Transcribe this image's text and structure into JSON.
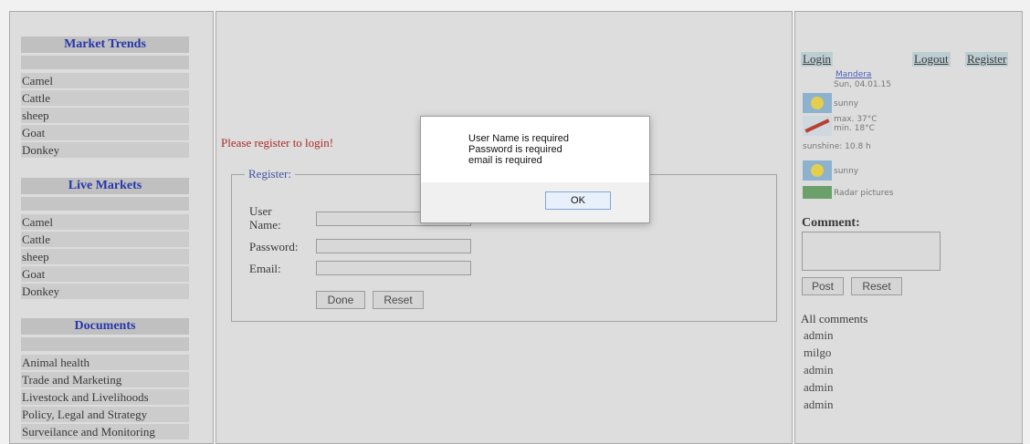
{
  "sidebar": {
    "sections": [
      {
        "title": "Market Trends",
        "items": [
          "Camel",
          "Cattle",
          "sheep",
          "Goat",
          "Donkey"
        ]
      },
      {
        "title": "Live Markets",
        "items": [
          "Camel",
          "Cattle",
          "sheep",
          "Goat",
          "Donkey"
        ]
      },
      {
        "title": "Documents",
        "items": [
          "Animal health",
          "Trade and Marketing",
          "Livestock and Livelihoods",
          "Policy, Legal and Strategy",
          "Surveilance and Monitoring"
        ]
      }
    ]
  },
  "main": {
    "message": "Please register to login!",
    "form": {
      "legend": "Register:",
      "user_label": "User Name:",
      "password_label": "Password:",
      "email_label": "Email:",
      "user_value": "",
      "password_value": "",
      "email_value": "",
      "done_label": "Done",
      "reset_label": "Reset"
    }
  },
  "right": {
    "login_label": "Login",
    "logout_label": "Logout",
    "register_label": "Register",
    "weather": {
      "location": "Mandera",
      "date": "Sun, 04.01.15",
      "condition1": "sunny",
      "max": "max.  37°C",
      "min": "min.   18°C",
      "sunshine": "sunshine: 10.8 h",
      "condition2": "sunny",
      "radar": "Radar pictures"
    },
    "comment_label": "Comment:",
    "post_label": "Post",
    "reset_label": "Reset",
    "all_comments_title": "All comments",
    "comments": [
      "admin",
      "milgo",
      "admin",
      "admin",
      "admin"
    ]
  },
  "dialog": {
    "lines": [
      "User Name is required",
      "Password is required",
      "email is required"
    ],
    "ok_label": "OK"
  },
  "colors": {
    "section_title": "#1f2fb0",
    "message": "#b22222",
    "link_bg": "#c6d8de"
  }
}
